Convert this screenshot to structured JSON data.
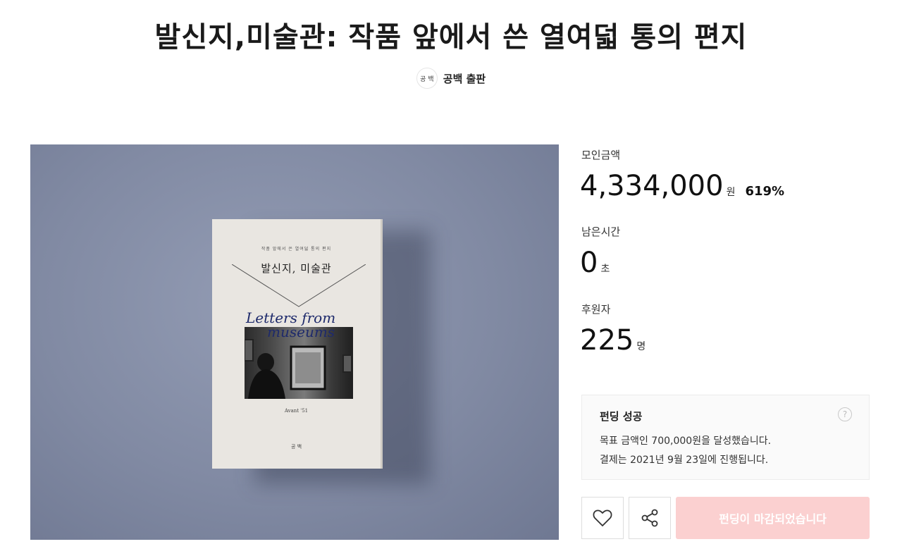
{
  "project": {
    "title": "발신지,미술관: 작품 앞에서 쓴 열여덟 통의 편지",
    "creator_logo_text": "공 백",
    "creator_name": "공백 출판"
  },
  "cover": {
    "tagline": "작품 앞에서 쓴 열여덟 통의 편지",
    "title": "발신지, 미술관",
    "script_line1": "Letters from",
    "script_line2": "museums",
    "author": "Avant '51",
    "publisher": "공 백"
  },
  "stats": {
    "amount_label": "모인금액",
    "amount_value": "4,334,000",
    "amount_unit": "원",
    "rate": "619%",
    "time_label": "남은시간",
    "time_value": "0",
    "time_unit": "초",
    "backers_label": "후원자",
    "backers_value": "225",
    "backers_unit": "명"
  },
  "status": {
    "title": "펀딩 성공",
    "line1": "목표 금액인 700,000원을 달성했습니다.",
    "line2": "결제는 2021년 9월 23일에 진행됩니다.",
    "help_glyph": "?"
  },
  "actions": {
    "like_icon": "heart-icon",
    "share_icon": "share-icon",
    "closed_label": "펀딩이 마감되었습니다"
  },
  "colors": {
    "cover_bg": "#818aa3",
    "closed_button_bg": "#fbd0d0",
    "script_ink": "#1e2a6b"
  }
}
